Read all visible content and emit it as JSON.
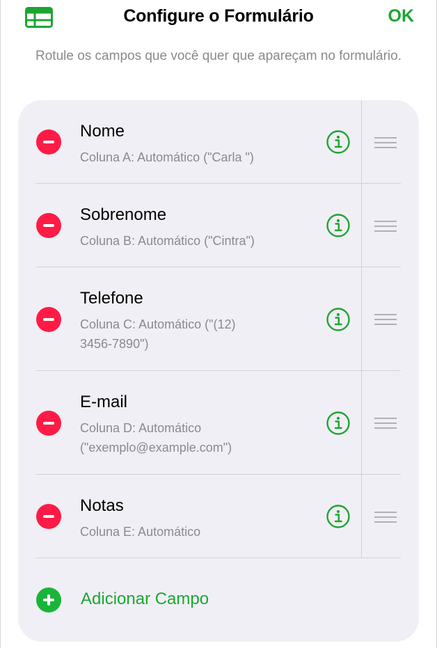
{
  "header": {
    "title": "Configure o Formulário",
    "done_label": "OK",
    "table_icon": "table-icon"
  },
  "subtitle": "Rotule os campos que você quer que apareçam no formulário.",
  "fields": [
    {
      "title": "Nome",
      "detail": "Coluna A: Automático (\"Carla \")"
    },
    {
      "title": "Sobrenome",
      "detail": "Coluna B: Automático (\"Cintra\")"
    },
    {
      "title": "Telefone",
      "detail": "Coluna C: Automático (\"(12) 3456-7890\")"
    },
    {
      "title": "E-mail",
      "detail": "Coluna D: Automático (\"exemplo@example.com\")"
    },
    {
      "title": "Notas",
      "detail": "Coluna E: Automático"
    }
  ],
  "add_field_label": "Adicionar Campo",
  "colors": {
    "accent_green": "#1ea531",
    "remove_red": "#ff1b45",
    "card_background": "#f0eff5",
    "secondary_text": "#8a8a8e"
  },
  "icons": {
    "remove": "minus-circle-icon",
    "info": "info-circle-icon",
    "reorder": "reorder-grip-icon",
    "add": "plus-circle-icon"
  }
}
